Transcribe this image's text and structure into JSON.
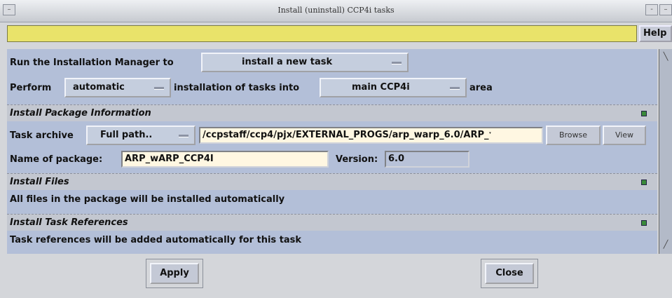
{
  "window": {
    "title": "Install (uninstall) CCP4i tasks",
    "menu_symbol": "–",
    "min_symbol": "-",
    "max_symbol": "–"
  },
  "help": {
    "label": "Help"
  },
  "run_row": {
    "label": "Run the Installation Manager to",
    "mode_value": "install a new task"
  },
  "perform_row": {
    "label_prefix": "Perform",
    "method_value": "automatic",
    "label_middle": "installation of tasks into",
    "area_value": "main CCP4i",
    "label_suffix": "area"
  },
  "sections": {
    "package_info": "Install Package Information",
    "files": "Install Files",
    "task_refs": "Install Task References"
  },
  "archive_row": {
    "label": "Task archive",
    "path_mode": "Full path..",
    "path_value": "/ccpstaff/ccp4/pjx/EXTERNAL_PROGS/arp_warp_6.0/ARP_ˑ",
    "browse_label": "Browse",
    "view_label": "View"
  },
  "package_row": {
    "name_label": "Name of package:",
    "name_value": "ARP_wARP_CCP4I",
    "version_label": "Version:",
    "version_value": "6.0"
  },
  "files_text": "All files in the package will be installed automatically",
  "refs_text": "Task references will be added automatically for this task",
  "footer": {
    "apply_label": "Apply",
    "close_label": "Close"
  },
  "scrollbar": {
    "up_arrow": "╲",
    "down_arrow": "╱"
  },
  "colors": {
    "banner": "#e9e36a",
    "panel": "#b3bfd8",
    "section": "#c3c7d0",
    "field": "#fff7e2",
    "indicator": "#3a8a3a"
  }
}
